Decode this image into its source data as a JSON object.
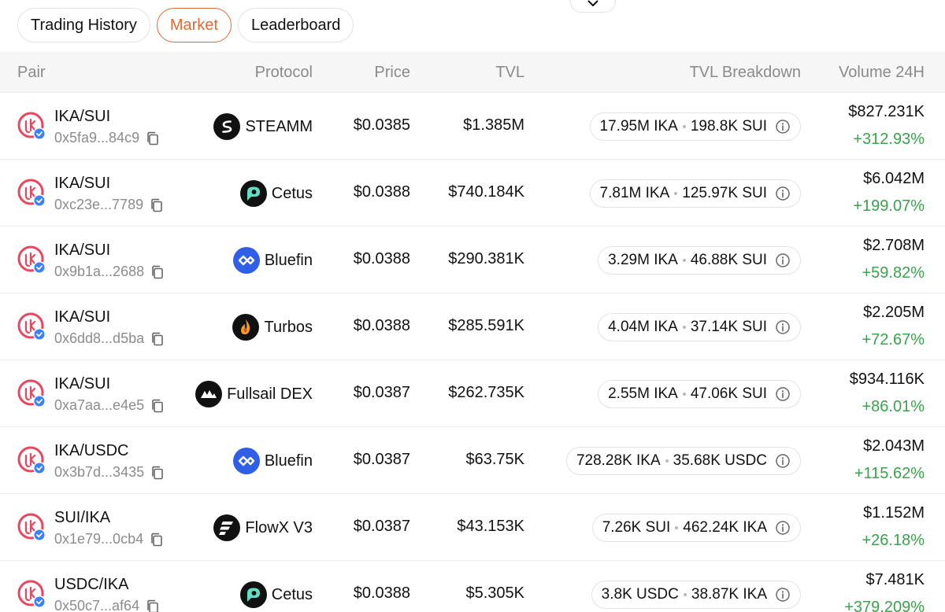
{
  "tabs": [
    {
      "label": "Trading History",
      "active": false
    },
    {
      "label": "Market",
      "active": true
    },
    {
      "label": "Leaderboard",
      "active": false
    }
  ],
  "columns": {
    "pair": "Pair",
    "protocol": "Protocol",
    "price": "Price",
    "tvl": "TVL",
    "tvl_breakdown": "TVL Breakdown",
    "volume": "Volume 24H"
  },
  "colors": {
    "accent": "#e06a35",
    "positive": "#3aa24c",
    "ika_red": "#e8475f",
    "usdc_blue": "#2f6fd8",
    "verified": "#3b82f6"
  },
  "rows": [
    {
      "pair": "IKA/SUI",
      "address": "0x5fa9...84c9",
      "protocol": "STEAMM",
      "protocol_icon": "steamm-icon",
      "price": "$0.0385",
      "tvl": "$1.385M",
      "amount_a": "17.95M IKA",
      "amount_b": "198.8K SUI",
      "volume": "$827.231K",
      "change": "+312.93%"
    },
    {
      "pair": "IKA/SUI",
      "address": "0xc23e...7789",
      "protocol": "Cetus",
      "protocol_icon": "cetus-icon",
      "price": "$0.0388",
      "tvl": "$740.184K",
      "amount_a": "7.81M IKA",
      "amount_b": "125.97K SUI",
      "volume": "$6.042M",
      "change": "+199.07%"
    },
    {
      "pair": "IKA/SUI",
      "address": "0x9b1a...2688",
      "protocol": "Bluefin",
      "protocol_icon": "bluefin-icon",
      "price": "$0.0388",
      "tvl": "$290.381K",
      "amount_a": "3.29M IKA",
      "amount_b": "46.88K SUI",
      "volume": "$2.708M",
      "change": "+59.82%"
    },
    {
      "pair": "IKA/SUI",
      "address": "0x6dd8...d5ba",
      "protocol": "Turbos",
      "protocol_icon": "turbos-icon",
      "price": "$0.0388",
      "tvl": "$285.591K",
      "amount_a": "4.04M IKA",
      "amount_b": "37.14K SUI",
      "volume": "$2.205M",
      "change": "+72.67%"
    },
    {
      "pair": "IKA/SUI",
      "address": "0xa7aa...e4e5",
      "protocol": "Fullsail DEX",
      "protocol_icon": "fullsail-icon",
      "price": "$0.0387",
      "tvl": "$262.735K",
      "amount_a": "2.55M IKA",
      "amount_b": "47.06K SUI",
      "volume": "$934.116K",
      "change": "+86.01%"
    },
    {
      "pair": "IKA/USDC",
      "address": "0x3b7d...3435",
      "protocol": "Bluefin",
      "protocol_icon": "bluefin-icon",
      "price": "$0.0387",
      "tvl": "$63.75K",
      "amount_a": "728.28K IKA",
      "amount_b": "35.68K USDC",
      "volume": "$2.043M",
      "change": "+115.62%"
    },
    {
      "pair": "SUI/IKA",
      "address": "0x1e79...0cb4",
      "protocol": "FlowX V3",
      "protocol_icon": "flowx-icon",
      "price": "$0.0387",
      "tvl": "$43.153K",
      "amount_a": "7.26K SUI",
      "amount_b": "462.24K IKA",
      "volume": "$1.152M",
      "change": "+26.18%"
    },
    {
      "pair": "USDC/IKA",
      "address": "0x50c7...af64",
      "protocol": "Cetus",
      "protocol_icon": "cetus-icon",
      "price": "$0.0388",
      "tvl": "$5.305K",
      "amount_a": "3.8K USDC",
      "amount_b": "38.87K IKA",
      "volume": "$7.481K",
      "change": "+379.209%"
    }
  ]
}
